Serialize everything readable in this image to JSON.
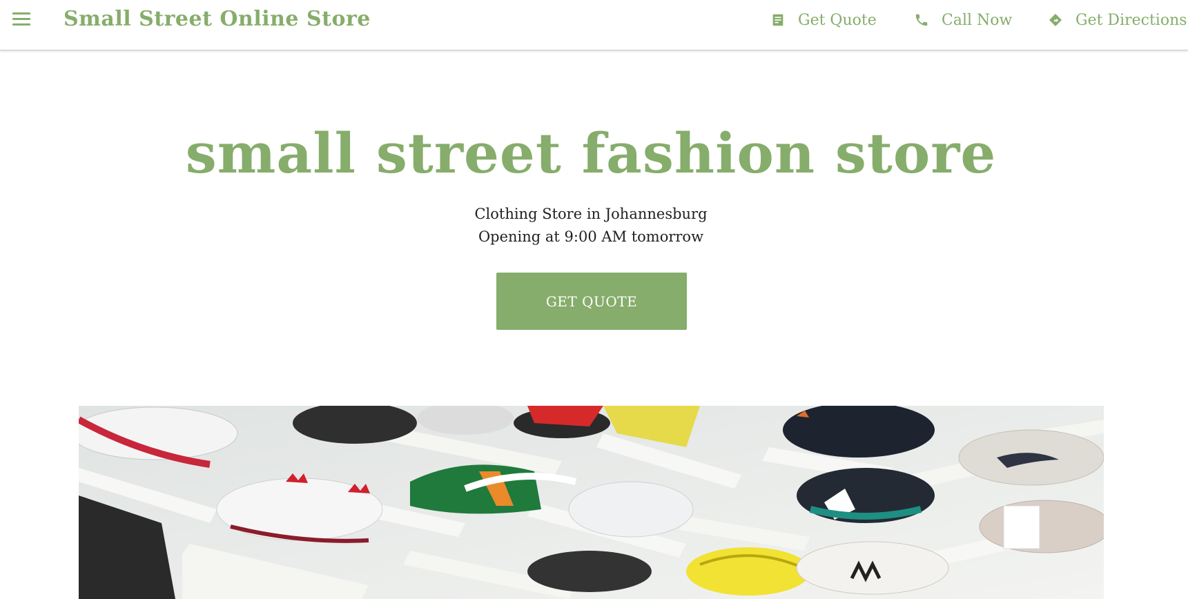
{
  "header": {
    "menu_icon": "hamburger-menu-icon",
    "brand": "Small Street Online Store",
    "actions": [
      {
        "label": "Get Quote",
        "icon": "document-icon"
      },
      {
        "label": "Call Now",
        "icon": "phone-icon"
      },
      {
        "label": "Get Directions",
        "icon": "directions-icon"
      }
    ]
  },
  "hero": {
    "title": "small street fashion store",
    "subtitle_line1": "Clothing Store in Johannesburg",
    "subtitle_line2": "Opening at 9:00 AM tomorrow",
    "cta_label": "GET QUOTE",
    "image": "sneaker-wall-photo"
  },
  "colors": {
    "accent": "#86ad6b",
    "text": "#1f1f1f",
    "background": "#ffffff"
  }
}
